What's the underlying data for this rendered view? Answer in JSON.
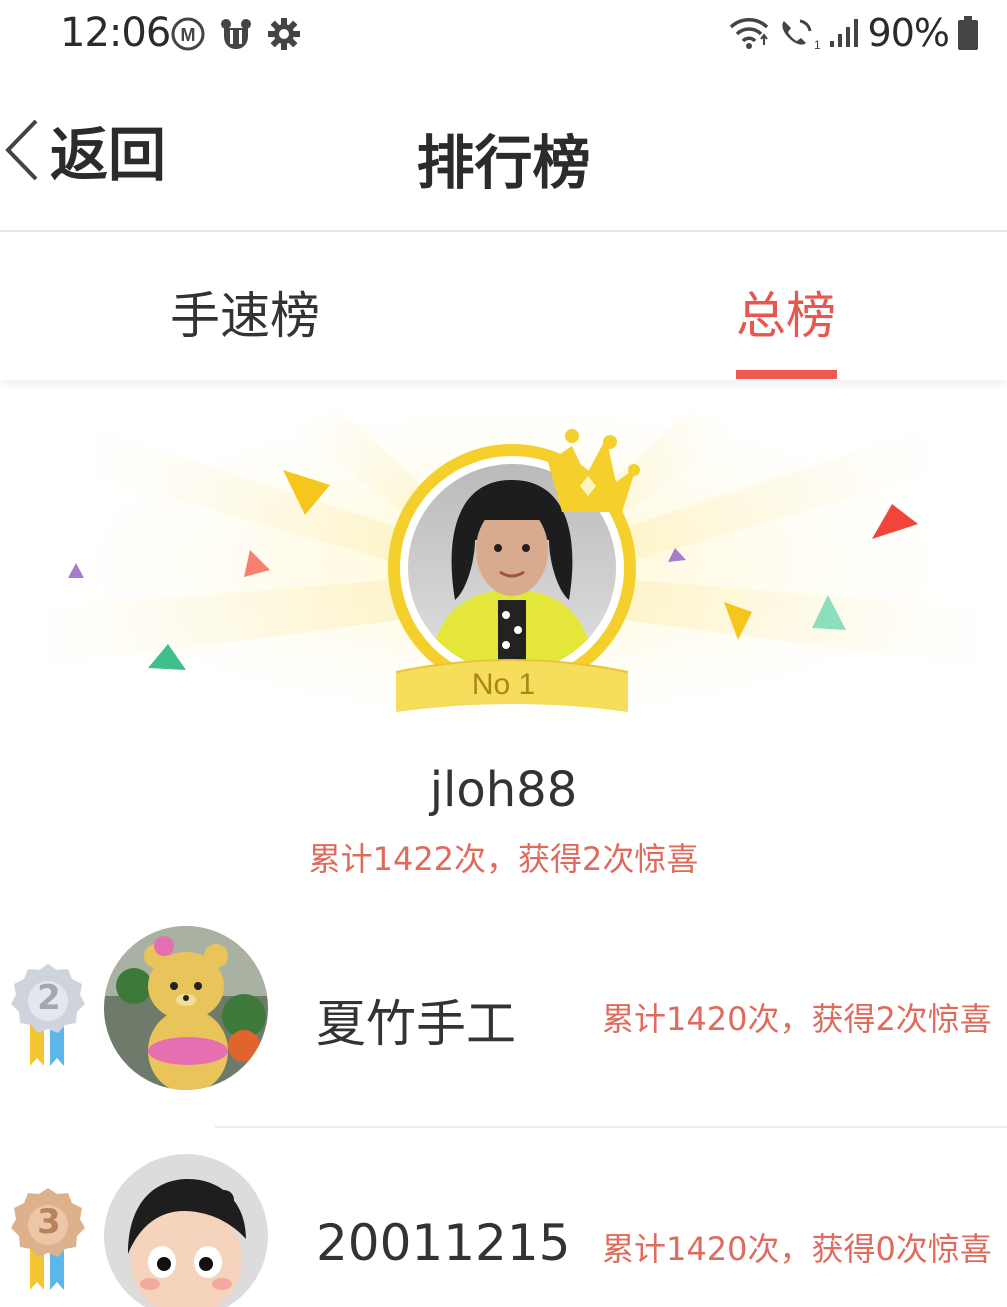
{
  "status_bar": {
    "time": "12:06",
    "left_icons": [
      "m-badge-icon",
      "bear-icon",
      "settings-gear-icon"
    ],
    "right_icons": [
      "wifi-icon",
      "wifi-call-icon",
      "signal-icon",
      "battery-icon"
    ],
    "battery": "90%"
  },
  "nav": {
    "back_label": "返回",
    "title": "排行榜"
  },
  "tabs": [
    {
      "label": "手速榜",
      "active": false
    },
    {
      "label": "总榜",
      "active": true
    }
  ],
  "colors": {
    "accent": "#ee5a4f",
    "stat_text": "#e06a5c",
    "gold": "#f5cf2b"
  },
  "champion": {
    "badge": "No 1",
    "username": "jloh88",
    "stat": "累计1422次，获得2次惊喜"
  },
  "ranks": [
    {
      "rank": "2",
      "name": "夏竹手工",
      "stat": "累计1420次，获得2次惊喜"
    },
    {
      "rank": "3",
      "name": "20011215",
      "stat": "累计1420次，获得0次惊喜"
    }
  ]
}
